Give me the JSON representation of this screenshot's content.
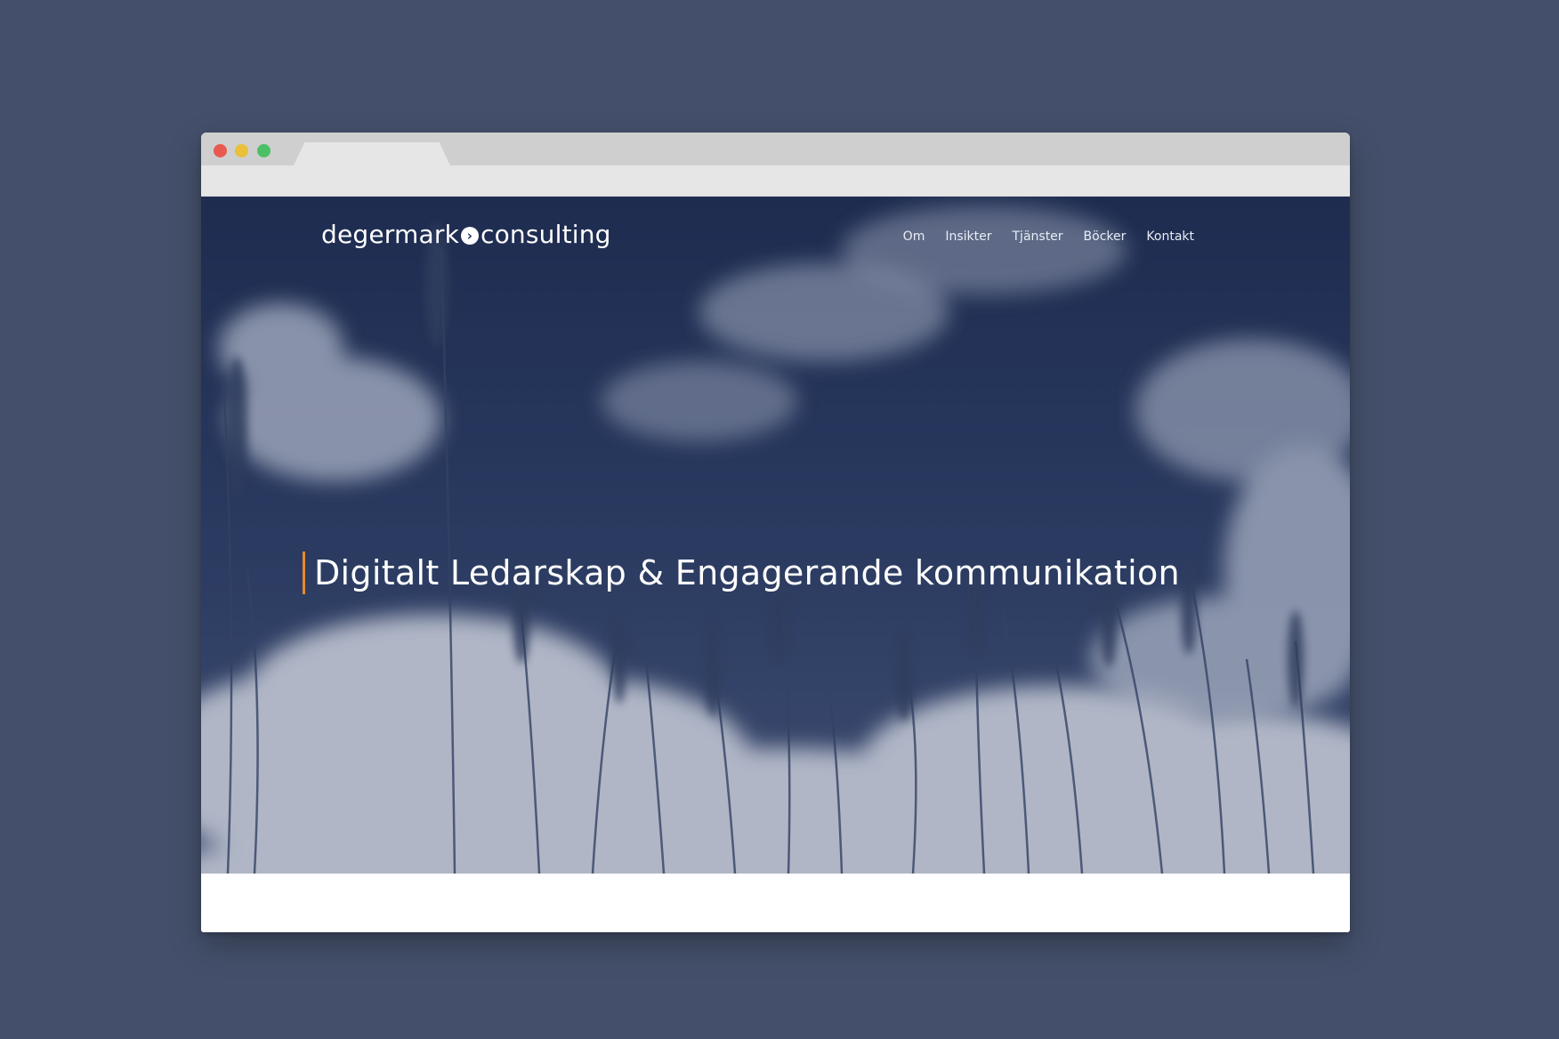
{
  "browser": {
    "window_buttons": [
      "close",
      "minimize",
      "maximize"
    ],
    "colors": {
      "close": "#e85a4f",
      "minimize": "#e8c03a",
      "maximize": "#4cc065"
    }
  },
  "site": {
    "logo": {
      "left": "degermark",
      "right": "consulting",
      "mark_icon": "chevron-right-icon",
      "mark_glyph": "›"
    },
    "nav": [
      {
        "label": "Om"
      },
      {
        "label": "Insikter"
      },
      {
        "label": "Tjänster"
      },
      {
        "label": "Böcker"
      },
      {
        "label": "Kontakt"
      }
    ],
    "hero": {
      "headline": "Digitalt Ledarskap & Engagerande kommunikation",
      "accent_color": "#e8892f",
      "background": "sky-with-clouds-and-grass"
    }
  }
}
